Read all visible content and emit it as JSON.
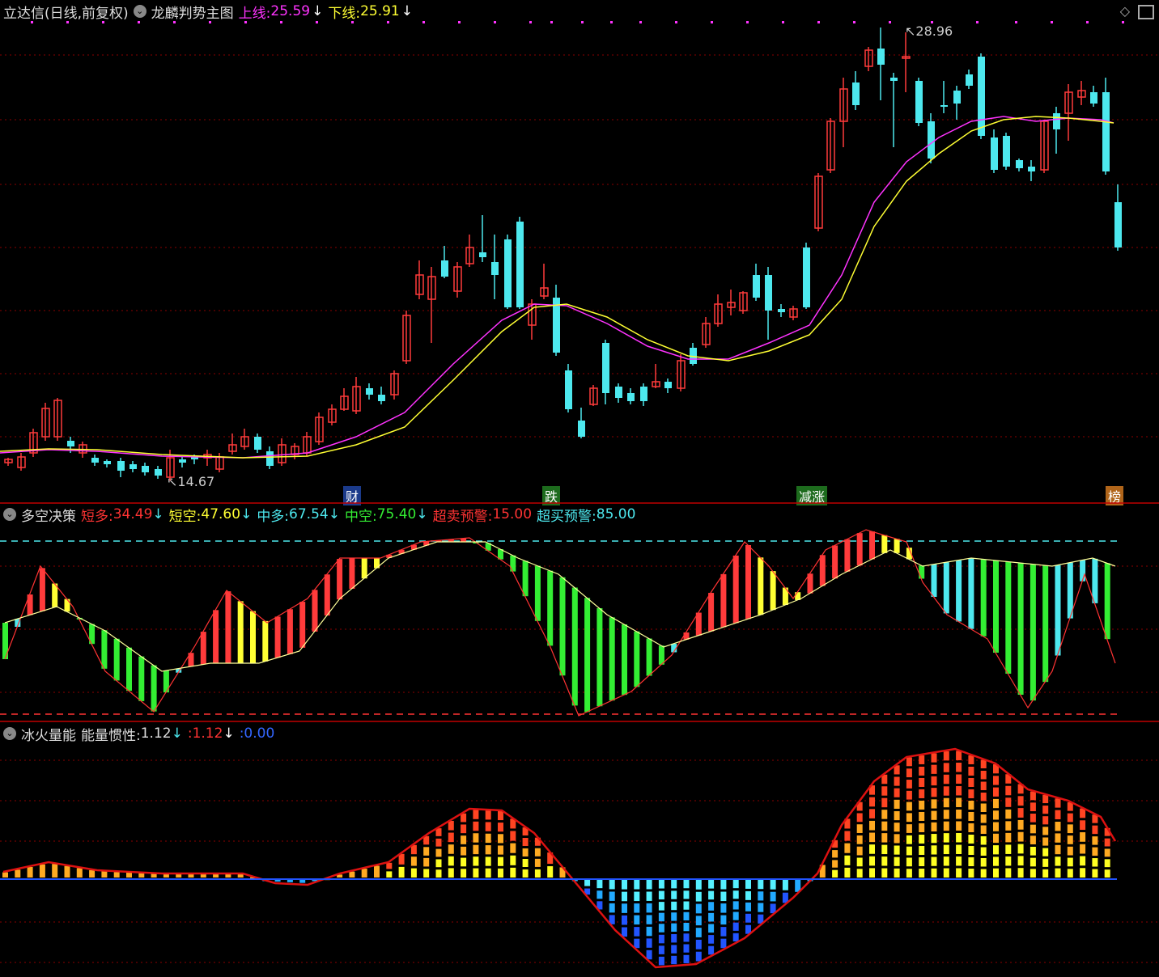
{
  "main_panel": {
    "software": "立达信(日线,前复权)",
    "indicator": "龙麟判势主图",
    "up_line_label": "上线:",
    "up_line_value": "25.59",
    "down_line_label": "下线:",
    "down_line_value": "25.91",
    "high_label": "28.96",
    "low_label": "14.67",
    "markers": {
      "cai": "财",
      "die": "跌",
      "jianzhang": "减涨",
      "bang": "榜"
    }
  },
  "mid_panel": {
    "name": "多空决策",
    "short_long_label": "短多:",
    "short_long_value": "34.49",
    "short_short_label": "短空:",
    "short_short_value": "47.60",
    "mid_long_label": "中多:",
    "mid_long_value": "67.54",
    "mid_short_label": "中空:",
    "mid_short_value": "75.40",
    "oversold_label": "超卖预警:",
    "oversold_value": "15.00",
    "overbought_label": "超买预警:",
    "overbought_value": "85.00"
  },
  "bottom_panel": {
    "name": "冰火量能",
    "inertia_label": "能量惯性:",
    "inertia_value": "1.12",
    "second_value": "1.12",
    "third_value": "0.00"
  },
  "colors": {
    "up": "#ff3b3b",
    "down": "#4de8ee",
    "magenta": "#ff33ff",
    "yellow": "#ffff33",
    "green": "#33ee33",
    "grid": "#8b0000"
  },
  "icons": {
    "collapse": "circle-chevron-icon",
    "window_restore": "diamond-icon",
    "window_max": "maximize-icon"
  }
}
